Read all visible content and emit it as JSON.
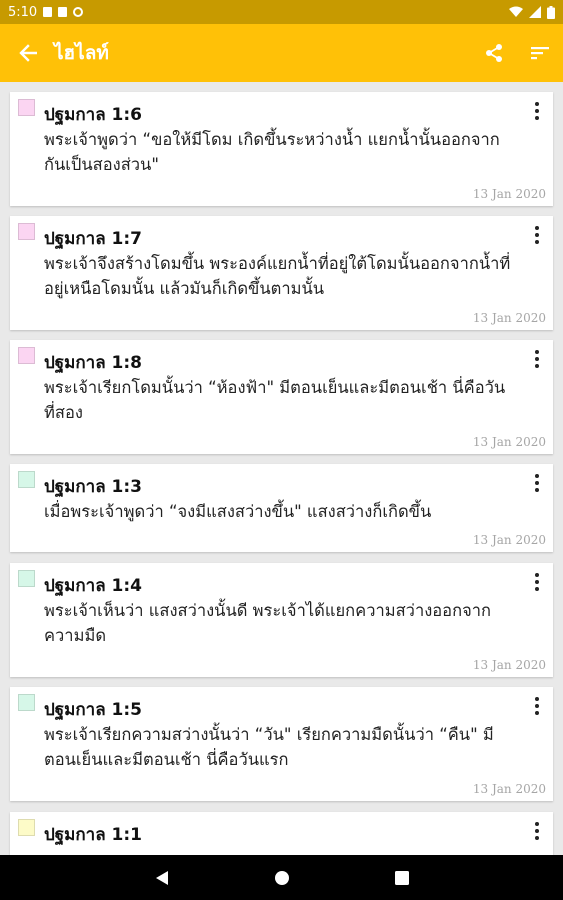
{
  "status_bar": {
    "time": "5:10",
    "icons": [
      "notification-icon",
      "sd-card-icon",
      "sync-icon",
      "wifi-icon",
      "signal-icon",
      "battery-icon"
    ]
  },
  "app_bar": {
    "title": "ไฮไลท์",
    "back_icon": "arrow-back-icon",
    "share_icon": "share-icon",
    "sort_icon": "sort-icon"
  },
  "colors": {
    "app_bar": "#ffc107",
    "status_bar": "#c79a00",
    "background": "#e9e9e9"
  },
  "highlights": [
    {
      "reference": "ปฐมกาล 1:6",
      "text": "พระเจ้าพูดว่า “ขอให้มีโดม เกิดขึ้นระหว่างน้ำ แยกน้ำนั้นออกจากกันเป็นสองส่วน\"",
      "date": "13 Jan 2020",
      "color": "#fbd5f2"
    },
    {
      "reference": "ปฐมกาล 1:7",
      "text": "พระเจ้าจึงสร้างโดมขึ้น พระองค์แยกน้ำที่อยู่ใต้โดมนั้นออกจากน้ำที่อยู่เหนือโดมนั้น แล้วมันก็เกิดขึ้นตามนั้น",
      "date": "13 Jan 2020",
      "color": "#fbd5f2"
    },
    {
      "reference": "ปฐมกาล 1:8",
      "text": "พระเจ้าเรียกโดมนั้นว่า “ห้องฟ้า\" มีตอนเย็นและมีตอนเช้า นี่คือวันที่สอง",
      "date": "13 Jan 2020",
      "color": "#fbd5f2"
    },
    {
      "reference": "ปฐมกาล 1:3",
      "text": "เมื่อพระเจ้าพูดว่า “จงมีแสงสว่างขึ้น\" แสงสว่างก็เกิดขึ้น",
      "date": "13 Jan 2020",
      "color": "#d6f7e8"
    },
    {
      "reference": "ปฐมกาล 1:4",
      "text": "พระเจ้าเห็นว่า แสงสว่างนั้นดี พระเจ้าได้แยกความสว่างออกจากความมืด",
      "date": "13 Jan 2020",
      "color": "#d6f7e8"
    },
    {
      "reference": "ปฐมกาล 1:5",
      "text": "พระเจ้าเรียกความสว่างนั้นว่า “วัน\" เรียกความมืดนั้นว่า “คืน\" มีตอนเย็นและมีตอนเช้า นี่คือวันแรก",
      "date": "13 Jan 2020",
      "color": "#d6f7e8"
    },
    {
      "reference": "ปฐมกาล 1:1",
      "text": "",
      "date": "",
      "color": "#fdfbc8"
    }
  ],
  "nav_bar": {
    "icons": [
      "back-triangle-icon",
      "home-circle-icon",
      "recents-square-icon"
    ]
  }
}
